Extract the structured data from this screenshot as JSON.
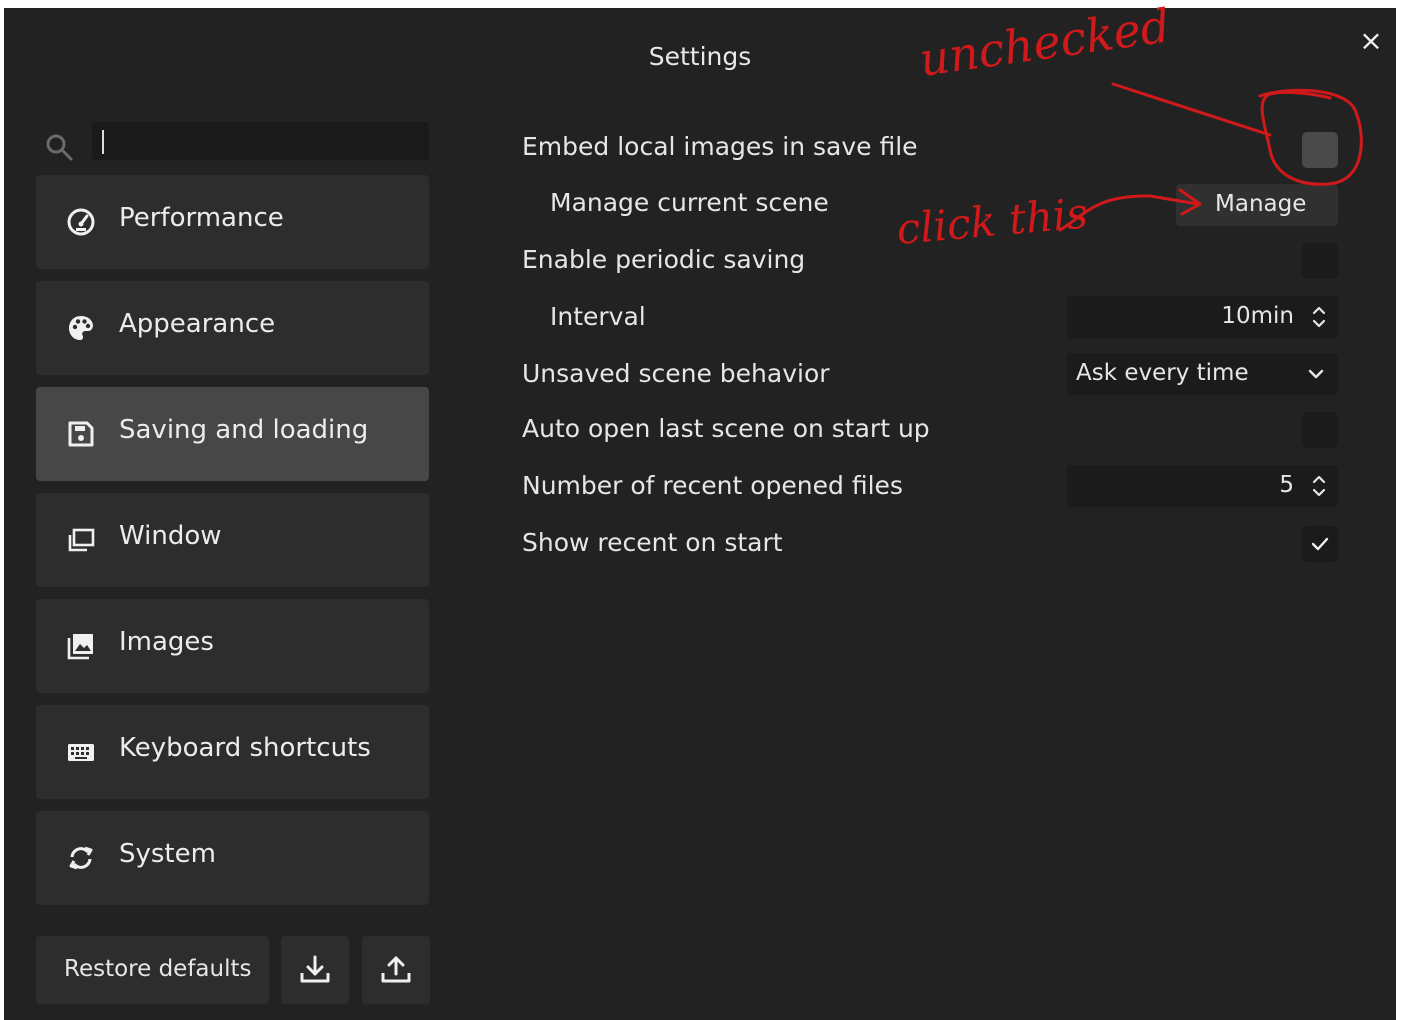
{
  "dialog": {
    "title": "Settings",
    "close_label": "×"
  },
  "search": {
    "value": "",
    "placeholder": ""
  },
  "sidebar": {
    "items": [
      {
        "label": "Performance",
        "icon": "gauge-icon"
      },
      {
        "label": "Appearance",
        "icon": "palette-icon"
      },
      {
        "label": "Saving and loading",
        "icon": "save-icon",
        "active": true
      },
      {
        "label": "Window",
        "icon": "window-icon"
      },
      {
        "label": "Images",
        "icon": "images-icon"
      },
      {
        "label": "Keyboard shortcuts",
        "icon": "keyboard-icon"
      },
      {
        "label": "System",
        "icon": "sync-icon"
      }
    ],
    "restore_label": "Restore defaults"
  },
  "settings": {
    "embed_images": {
      "label": "Embed local images in save file",
      "checked": false
    },
    "manage_scene": {
      "label": "Manage current scene",
      "button_label": "Manage"
    },
    "periodic_saving": {
      "label": "Enable periodic saving",
      "checked": false
    },
    "interval": {
      "label": "Interval",
      "value": "10min"
    },
    "unsaved_behavior": {
      "label": "Unsaved scene behavior",
      "selected": "Ask every time"
    },
    "auto_open": {
      "label": "Auto open last scene on start up",
      "checked": false
    },
    "recent_files": {
      "label": "Number of recent opened files",
      "value": "5"
    },
    "show_recent": {
      "label": "Show recent on start",
      "checked": true
    }
  },
  "annotations": {
    "top_note": "unchecked",
    "middle_note": "click this",
    "color": "#d0191a"
  },
  "colors": {
    "background": "#222222",
    "panel": "#2d2d2d",
    "active": "#474747",
    "field": "#1b1b1b"
  }
}
